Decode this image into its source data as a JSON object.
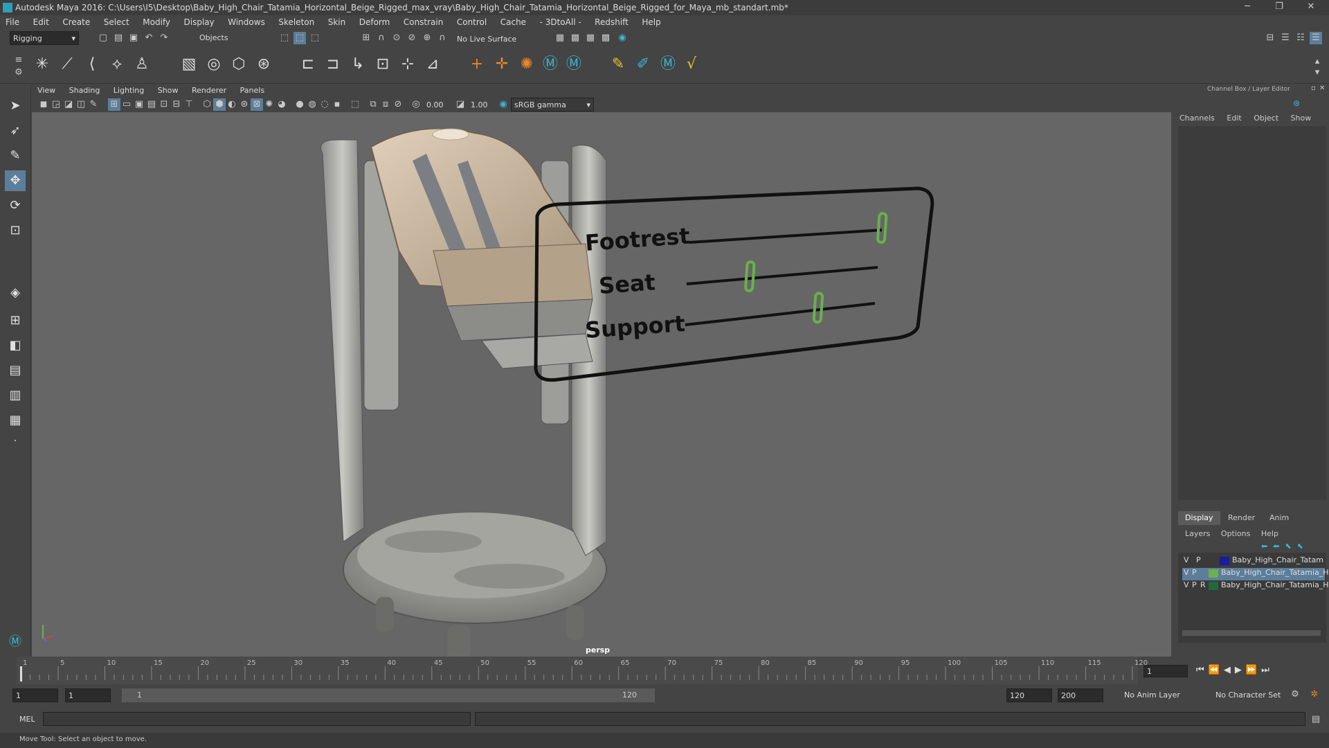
{
  "window": {
    "title": "Autodesk Maya 2016: C:\\Users\\I5\\Desktop\\Baby_High_Chair_Tatamia_Horizontal_Beige_Rigged_max_vray\\Baby_High_Chair_Tatamia_Horizontal_Beige_Rigged_for_Maya_mb_standart.mb*",
    "minimize": "─",
    "restore": "❐",
    "close": "✕"
  },
  "menubar": [
    "File",
    "Edit",
    "Create",
    "Select",
    "Modify",
    "Display",
    "Windows",
    "Skeleton",
    "Skin",
    "Deform",
    "Constrain",
    "Control",
    "Cache",
    "- 3DtoAll -",
    "Redshift",
    "Help"
  ],
  "status": {
    "menuset": "Rigging",
    "selection_mode": "Objects",
    "live_surface": "No Live Surface"
  },
  "viewport": {
    "menu": [
      "View",
      "Shading",
      "Lighting",
      "Show",
      "Renderer",
      "Panels"
    ],
    "exposure": "0.00",
    "gamma": "1.00",
    "color_space": "sRGB gamma",
    "camera_label": "persp",
    "sliders_panel": {
      "labels": [
        "Footrest",
        "Seat",
        "Support"
      ],
      "values": [
        1.0,
        0.33,
        0.7
      ]
    }
  },
  "channel_box": {
    "header": "Channel Box / Layer Editor",
    "menu": [
      "Channels",
      "Edit",
      "Object",
      "Show"
    ]
  },
  "layer_editor": {
    "tabs": [
      "Display",
      "Render",
      "Anim"
    ],
    "menu": [
      "Layers",
      "Options",
      "Help"
    ],
    "layers": [
      {
        "v": "V",
        "p": "P",
        "name": "Baby_High_Chair_Tatam",
        "color": "#1b1ba0"
      },
      {
        "v": "V",
        "p": "P",
        "name": "Baby_High_Chair_Tatamia_Hc",
        "color": "#6ab04c"
      },
      {
        "v": "V",
        "p": "P",
        "r": "R",
        "name": "Baby_High_Chair_Tatamia_Hc",
        "color": "#1f6a3a"
      }
    ]
  },
  "timeline": {
    "ticks": [
      "1",
      "5",
      "10",
      "15",
      "20",
      "25",
      "30",
      "35",
      "40",
      "45",
      "50",
      "55",
      "60",
      "65",
      "70",
      "75",
      "80",
      "85",
      "90",
      "95",
      "100",
      "105",
      "110",
      "115",
      "120"
    ],
    "current_frame": "1"
  },
  "range": {
    "start": "1",
    "playback_start": "1",
    "slider_start": "1",
    "slider_end": "120",
    "playback_end": "120",
    "end": "200",
    "anim_layer": "No Anim Layer",
    "character_set": "No Character Set"
  },
  "command": {
    "label": "MEL"
  },
  "help": {
    "text": "Move Tool: Select an object to move."
  }
}
